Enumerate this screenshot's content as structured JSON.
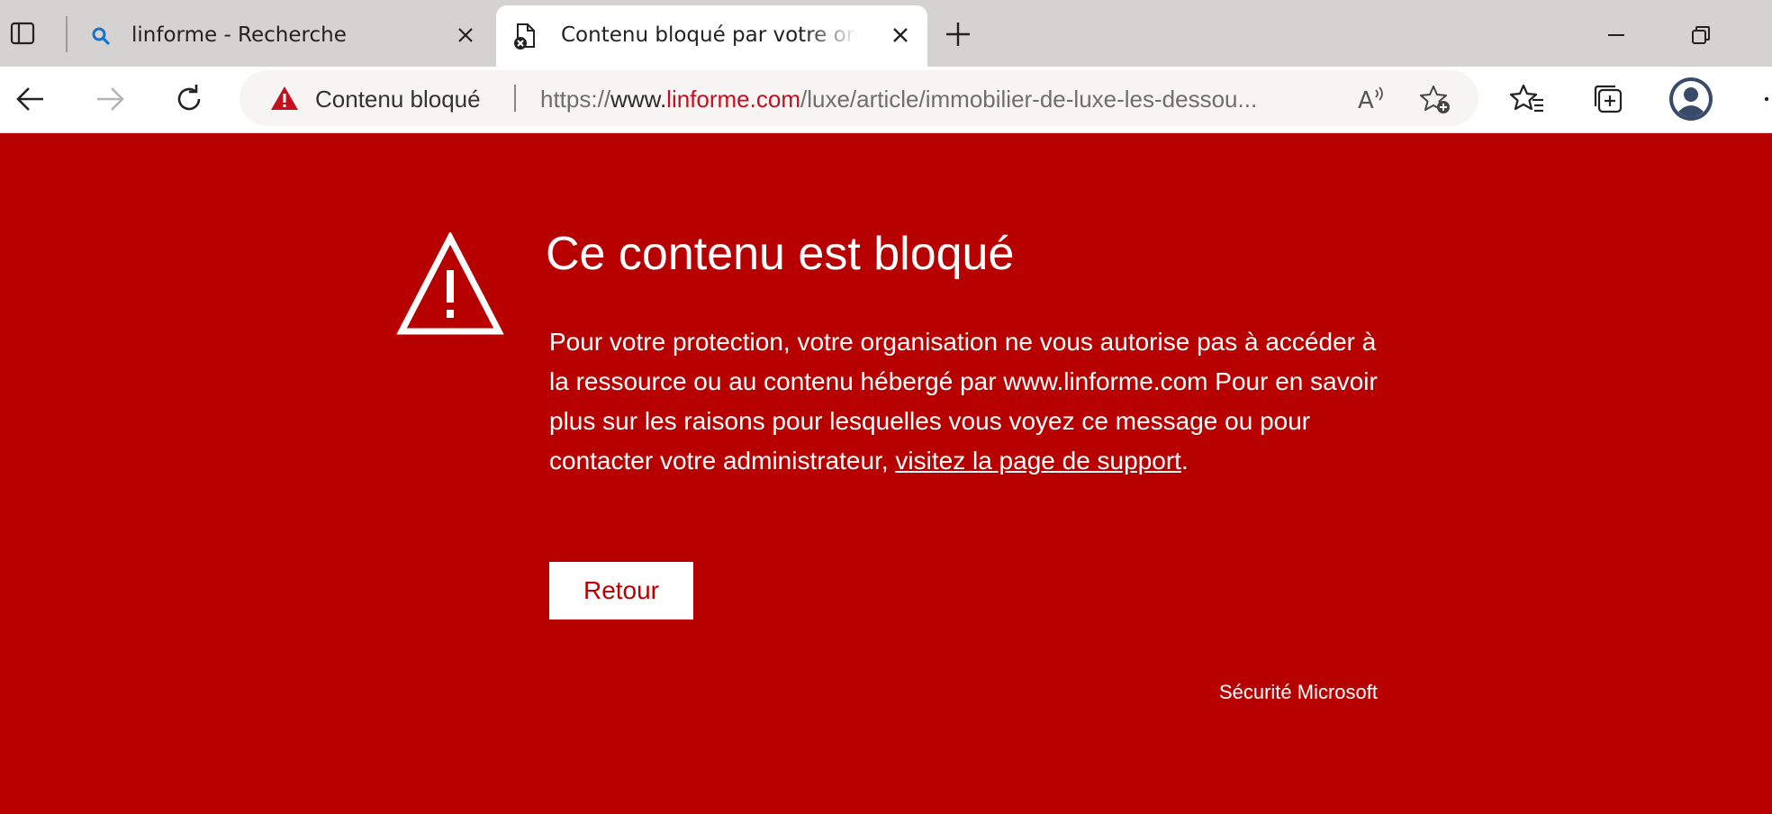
{
  "window": {
    "minimize_icon": "minimize-icon",
    "restore_icon": "restore-icon"
  },
  "tabs": [
    {
      "title": "linforme - Recherche",
      "icon": "search-icon",
      "active": false
    },
    {
      "title": "Contenu bloqué par votre organisation",
      "icon": "blocked-page-icon",
      "active": true
    }
  ],
  "toolbar": {
    "address": {
      "status_label": "Contenu bloqué",
      "url_scheme": "https://",
      "url_host_prefix": "www.",
      "url_domain": "linforme.com",
      "url_path": "/luxe/article/immobilier-de-luxe-les-dessou..."
    }
  },
  "content": {
    "title": "Ce contenu est bloqué",
    "message_part1": "Pour votre protection, votre organisation ne vous autorise pas à accéder à la ressource ou au contenu hébergé par www.linforme.com Pour en savoir plus sur les raisons pour lesquelles vous voyez ce message ou pour contacter votre administrateur, ",
    "support_link": "visitez la page de support",
    "message_end": ".",
    "back_button": "Retour",
    "footer": "Sécurité Microsoft"
  },
  "colors": {
    "page_background": "#b70000",
    "tabstrip_background": "#d5d3d1",
    "url_domain": "#c50f1f",
    "warning_icon": "#c50f1f"
  }
}
